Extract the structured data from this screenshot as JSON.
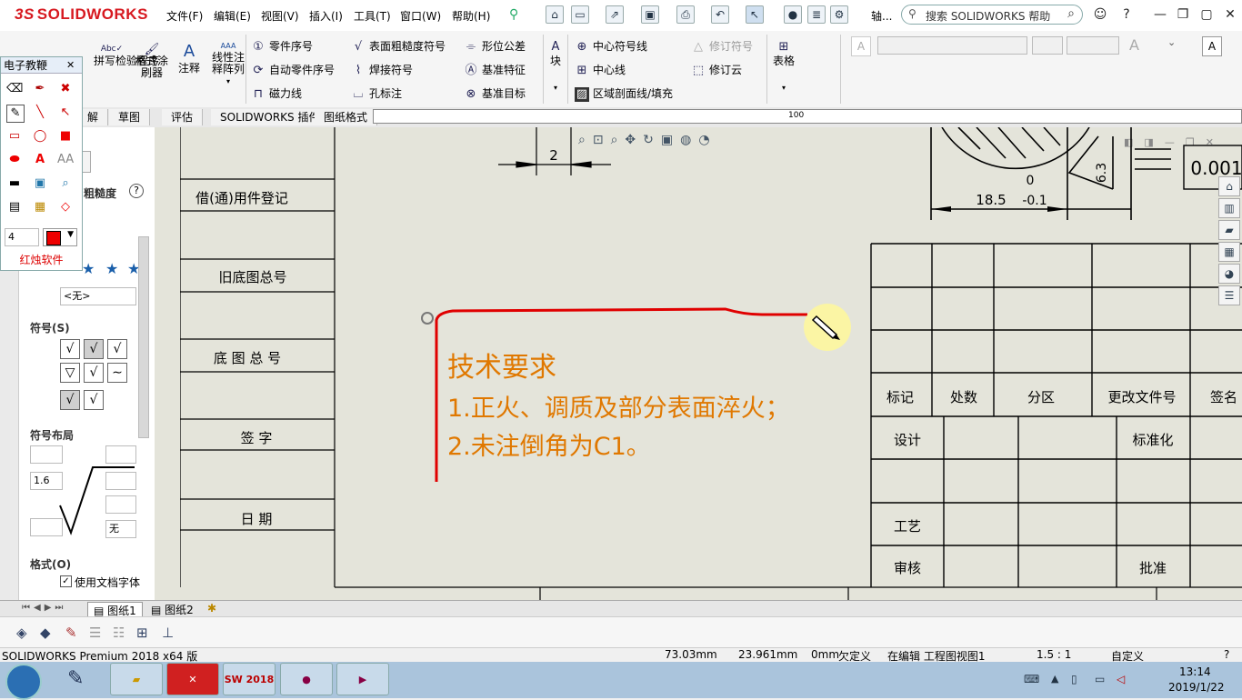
{
  "app": {
    "brand": "SOLIDWORKS",
    "brand_prefix": "3S",
    "menus": [
      "文件(F)",
      "编辑(E)",
      "视图(V)",
      "插入(I)",
      "工具(T)",
      "窗口(W)",
      "帮助(H)"
    ],
    "search_placeholder": "搜索 SOLIDWORKS 帮助",
    "axis_label": "轴..."
  },
  "ribbon": {
    "spell_check": "拼写检验程序",
    "format_painter": "格式涂刷器",
    "note": "注释",
    "linear_note": "线性注释阵列",
    "balloon": "零件序号",
    "auto_balloon": "自动零件序号",
    "magnetic_line": "磁力线",
    "surface_finish": "表面粗糙度符号",
    "weld_symbol": "焊接符号",
    "hole_callout": "孔标注",
    "gdt": "形位公差",
    "datum_feature": "基准特征",
    "datum_target": "基准目标",
    "block": "块",
    "center_mark": "中心符号线",
    "centerline": "中心线",
    "area_hatch": "区域剖面线/填充",
    "revision_symbol": "修订符号",
    "revision_cloud": "修订云",
    "table": "表格"
  },
  "tabs": [
    "解",
    "草图",
    "评估",
    "SOLIDWORKS 插件",
    "图纸格式"
  ],
  "ruler_label": "100",
  "ink_toolbar": {
    "title": "电子教鞭",
    "line_width": "4",
    "footer": "红烛软件",
    "pen_color": "#ff0000"
  },
  "left_panel": {
    "roughness_label": "粗糙度",
    "none_option": "<无>",
    "symbol_header": "符号(S)",
    "layout_header": "符号布局",
    "roughness_value": "1.6",
    "direction_value": "无",
    "format_header": "格式(O)",
    "use_doc_font": "使用文档字体"
  },
  "drawing": {
    "left_column": [
      "借(通)用件登记",
      "旧底图总号",
      "底 图 总 号",
      "签    字",
      "日    期"
    ],
    "dim_top": "2",
    "dim_right": "18.5",
    "tol_upper": "0",
    "tol_lower": "-0.1",
    "angle_label": "6.3",
    "flat_value": "0.001",
    "tech_title": "技术要求",
    "tech_line1": "1.正火、调质及部分表面淬火；",
    "tech_line2": "2.未注倒角为C1。",
    "title_block": {
      "row_marks": [
        "标记",
        "处数",
        "分区",
        "更改文件号",
        "签名"
      ],
      "design": "设计",
      "standardize": "标准化",
      "process": "工艺",
      "review": "审核",
      "approve": "批准"
    },
    "annotation_color": "#e07800",
    "ink_color": "#e00000"
  },
  "sheet_tabs": [
    "图纸1",
    "图纸2"
  ],
  "status": {
    "product": "SOLIDWORKS Premium 2018 x64 版",
    "x": "73.03mm",
    "y": "23.961mm",
    "z": "0mm",
    "state": "欠定义",
    "editing": "在编辑 工程图视图1",
    "scale": "1.5 : 1",
    "custom": "自定义"
  },
  "taskbar": {
    "time": "13:14",
    "date": "2019/1/22",
    "sw_label": "SW 2018"
  }
}
